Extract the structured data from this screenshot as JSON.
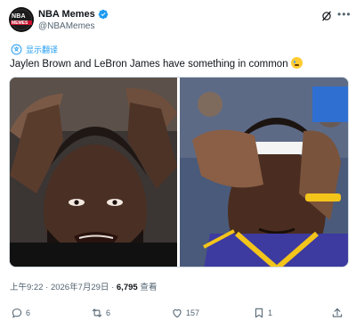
{
  "author": {
    "display_name": "NBA Memes",
    "handle": "@NBAMemes",
    "avatar_text_top": "NBA",
    "avatar_text_bottom": "MEMES",
    "verified_color": "#1d9bf0"
  },
  "translate": {
    "label": "显示翻译",
    "icon": "translate-icon"
  },
  "tweet": {
    "text": "Jaylen Brown and LeBron James have something in common",
    "emoji": "crying-face-emoji"
  },
  "media": {
    "left_image": "player-hands-on-head-photo",
    "right_image": "player-holding-headband-photo"
  },
  "meta": {
    "time": "上午9:22",
    "separator": "·",
    "date": "2026年7月29日",
    "views_count": "6,795",
    "views_label": "查看"
  },
  "actions": {
    "replies": "6",
    "reposts": "6",
    "likes": "157",
    "bookmarks": "1"
  },
  "colors": {
    "accent": "#1d9bf0",
    "text_primary": "#0f1419",
    "text_secondary": "#536471"
  }
}
